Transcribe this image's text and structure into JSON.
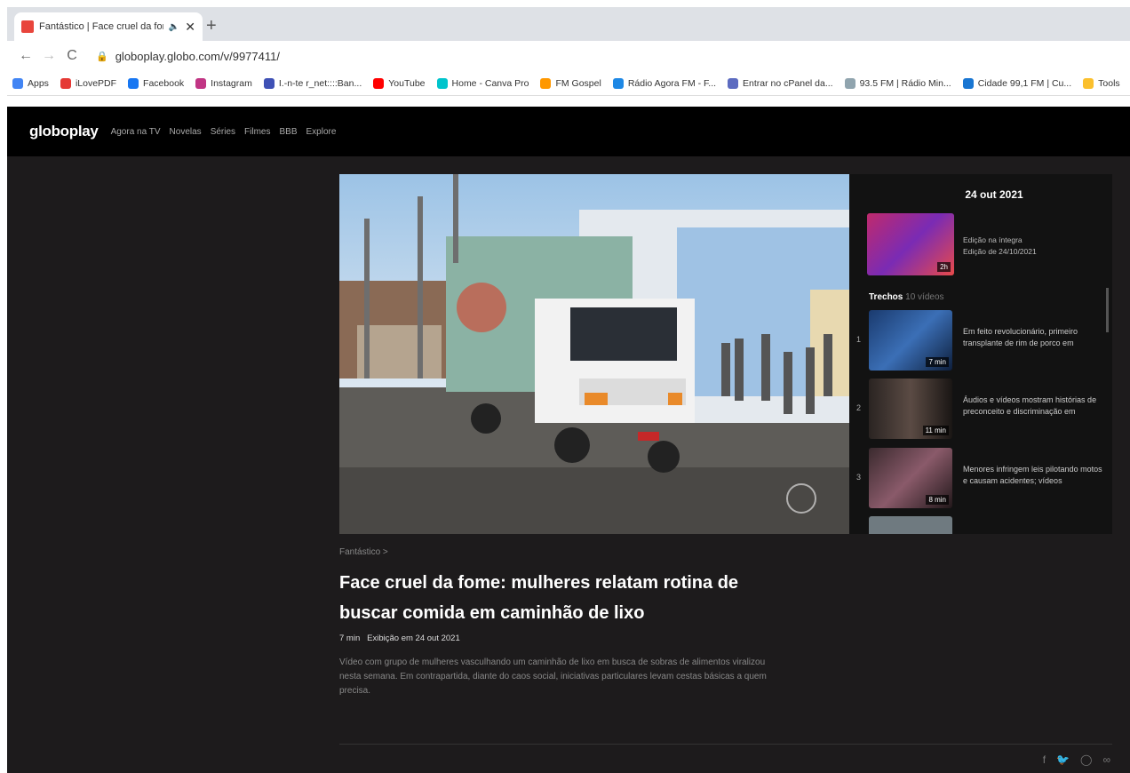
{
  "browser": {
    "tab_title": "Fantástico | Face cruel da fom",
    "url": "globoplay.globo.com/v/9977411/",
    "bookmarks": [
      {
        "label": "Apps",
        "color": "#4285f4"
      },
      {
        "label": "iLovePDF",
        "color": "#e53935"
      },
      {
        "label": "Facebook",
        "color": "#1877f2"
      },
      {
        "label": "Instagram",
        "color": "#c13584"
      },
      {
        "label": "I.-n-te r_net::::Ban...",
        "color": "#3f51b5"
      },
      {
        "label": "YouTube",
        "color": "#ff0000"
      },
      {
        "label": "Home - Canva Pro",
        "color": "#00c4cc"
      },
      {
        "label": "FM Gospel",
        "color": "#ff9800"
      },
      {
        "label": "Rádio Agora FM - F...",
        "color": "#1e88e5"
      },
      {
        "label": "Entrar no cPanel da...",
        "color": "#5c6bc0"
      },
      {
        "label": "93.5 FM | Rádio Min...",
        "color": "#90a4ae"
      },
      {
        "label": "Cidade 99,1 FM | Cu...",
        "color": "#1976d2"
      },
      {
        "label": "Tools",
        "color": "#fbc02d"
      }
    ]
  },
  "site": {
    "logo": "globoplay",
    "nav": [
      "Agora na TV",
      "Novelas",
      "Séries",
      "Filmes",
      "BBB",
      "Explore"
    ]
  },
  "sidebar": {
    "date": "24 out 2021",
    "full_episode": {
      "duration": "2h",
      "line1": "Edição na íntegra",
      "line2": "Edição de 24/10/2021"
    },
    "trechos_label": "Trechos",
    "trechos_count": "10 vídeos",
    "clips": [
      {
        "num": "1",
        "duration": "7 min",
        "text": "Em feito revolucionário, primeiro transplante de rim de porco em"
      },
      {
        "num": "2",
        "duration": "11 min",
        "text": "Áudios e vídeos mostram histórias de preconceito e discriminação em"
      },
      {
        "num": "3",
        "duration": "8 min",
        "text": "Menores infringem leis pilotando motos e causam acidentes; vídeos"
      }
    ]
  },
  "video_info": {
    "breadcrumb": "Fantástico >",
    "title": "Face cruel da fome: mulheres relatam rotina de buscar comida em caminhão de lixo",
    "duration": "7 min",
    "aired": "Exibição em 24 out 2021",
    "description": "Vídeo com grupo de mulheres vasculhando um caminhão de lixo em busca de sobras de alimentos viralizou nesta semana. Em contrapartida, diante do caos social, iniciativas particulares levam cestas básicas a quem precisa."
  }
}
